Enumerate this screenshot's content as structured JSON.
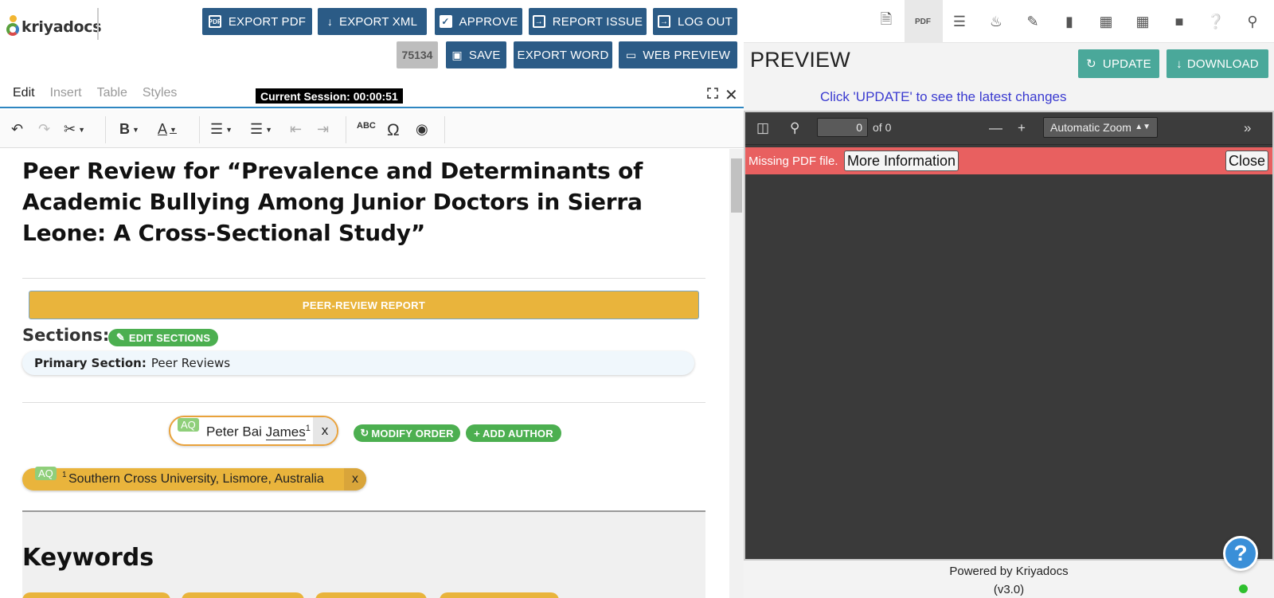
{
  "header": {
    "logo_text": "kriyadocs",
    "buttons": {
      "export_pdf": "EXPORT PDF",
      "export_xml": "EXPORT XML",
      "approve": "APPROVE",
      "report_issue": "REPORT ISSUE",
      "log_out": "LOG OUT",
      "save": "SAVE",
      "export_word": "EXPORT WORD",
      "web_preview": "WEB PREVIEW"
    },
    "job_id": "75134"
  },
  "editor_menu": {
    "tabs": [
      "Edit",
      "Insert",
      "Table",
      "Styles"
    ],
    "active_tab": "Edit",
    "session": "Current Session: 00:00:51"
  },
  "toolbar_icons": [
    "undo-icon",
    "redo-icon",
    "cut-icon",
    "bold-icon",
    "text-color-icon",
    "bullet-list-icon",
    "numbered-list-icon",
    "outdent-icon",
    "indent-icon",
    "spellcheck-icon",
    "special-char-icon",
    "preview-eye-icon"
  ],
  "document": {
    "title": "Peer Review for “Prevalence and Determinants of Academic Bullying Among Junior Doctors in Sierra Leone: A Cross-Sectional Study”",
    "report_bar": "PEER-REVIEW REPORT",
    "sections_label": "Sections:",
    "edit_sections": "EDIT SECTIONS",
    "primary_section_label": "Primary Section:",
    "primary_section_value": "Peer Reviews",
    "author": {
      "aq": "AQ",
      "first": "Peter Bai",
      "last": "James",
      "sup": "1",
      "remove": "x"
    },
    "modify_order": "MODIFY ORDER",
    "add_author": "ADD AUTHOR",
    "affiliation": {
      "aq": "AQ",
      "sup": "1",
      "text": "Southern Cross University, Lismore, Australia",
      "remove": "x"
    },
    "keywords_title": "Keywords"
  },
  "preview": {
    "title": "PREVIEW",
    "update": "UPDATE",
    "download": "DOWNLOAD",
    "hint": "Click 'UPDATE' to see the latest changes",
    "page_value": "0",
    "page_of": "of 0",
    "zoom": "Automatic Zoom",
    "error_text": "Missing PDF file.",
    "more_info": "More Information",
    "close": "Close",
    "footer_line1": "Powered by Kriyadocs",
    "footer_line2": "(v3.0)"
  },
  "right_toolbar_icons": [
    "word-doc-icon",
    "pdf-icon",
    "list-icon",
    "bell-icon",
    "notes-icon",
    "book-icon",
    "image-icon",
    "table-icon",
    "folder-icon",
    "help-icon",
    "search-icon"
  ],
  "colors": {
    "header_btn": "#2b5b86",
    "teal_btn": "#4aa89a",
    "report_bar": "#e9b43c",
    "green_pill": "#4caf50",
    "error_bar": "#e86060",
    "hint_text": "#3a3ad0"
  }
}
